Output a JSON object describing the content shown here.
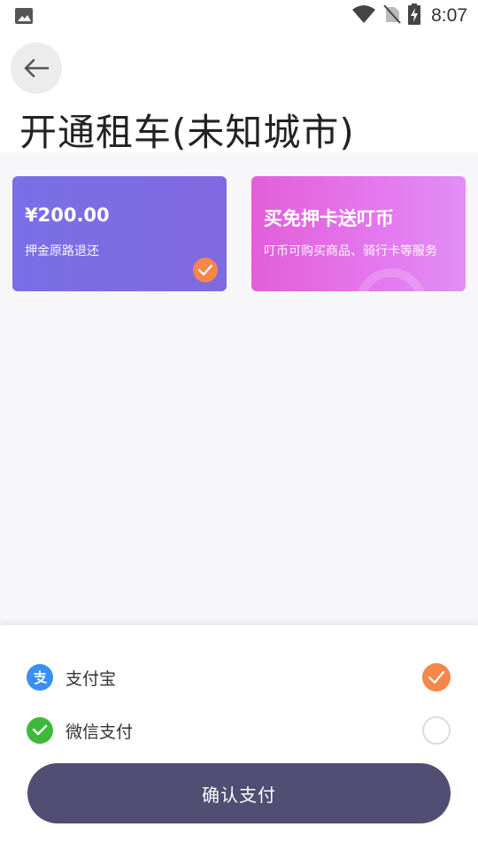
{
  "status_bar": {
    "time": "8:07",
    "icons": [
      "image-icon",
      "wifi-icon",
      "no-sim-icon",
      "battery-charging-icon"
    ]
  },
  "header": {
    "back_icon": "arrow-left-icon",
    "title": "开通租车(未知城市)"
  },
  "cards": [
    {
      "title": "¥200.00",
      "subtitle": "押金原路退还",
      "selected": true,
      "color": "#7a6fe6"
    },
    {
      "title": "买免押卡送叮币",
      "subtitle": "叮币可购买商品、骑行卡等服务",
      "selected": false,
      "color": "#e25fd8"
    }
  ],
  "payment": {
    "methods": [
      {
        "label": "支付宝",
        "icon": "alipay-icon",
        "selected": true,
        "color": "#3a8ff0"
      },
      {
        "label": "微信支付",
        "icon": "wechat-pay-icon",
        "selected": false,
        "color": "#3eb93a"
      }
    ],
    "confirm_label": "确认支付",
    "accent": "#f5874b",
    "button_color": "#514d73"
  }
}
